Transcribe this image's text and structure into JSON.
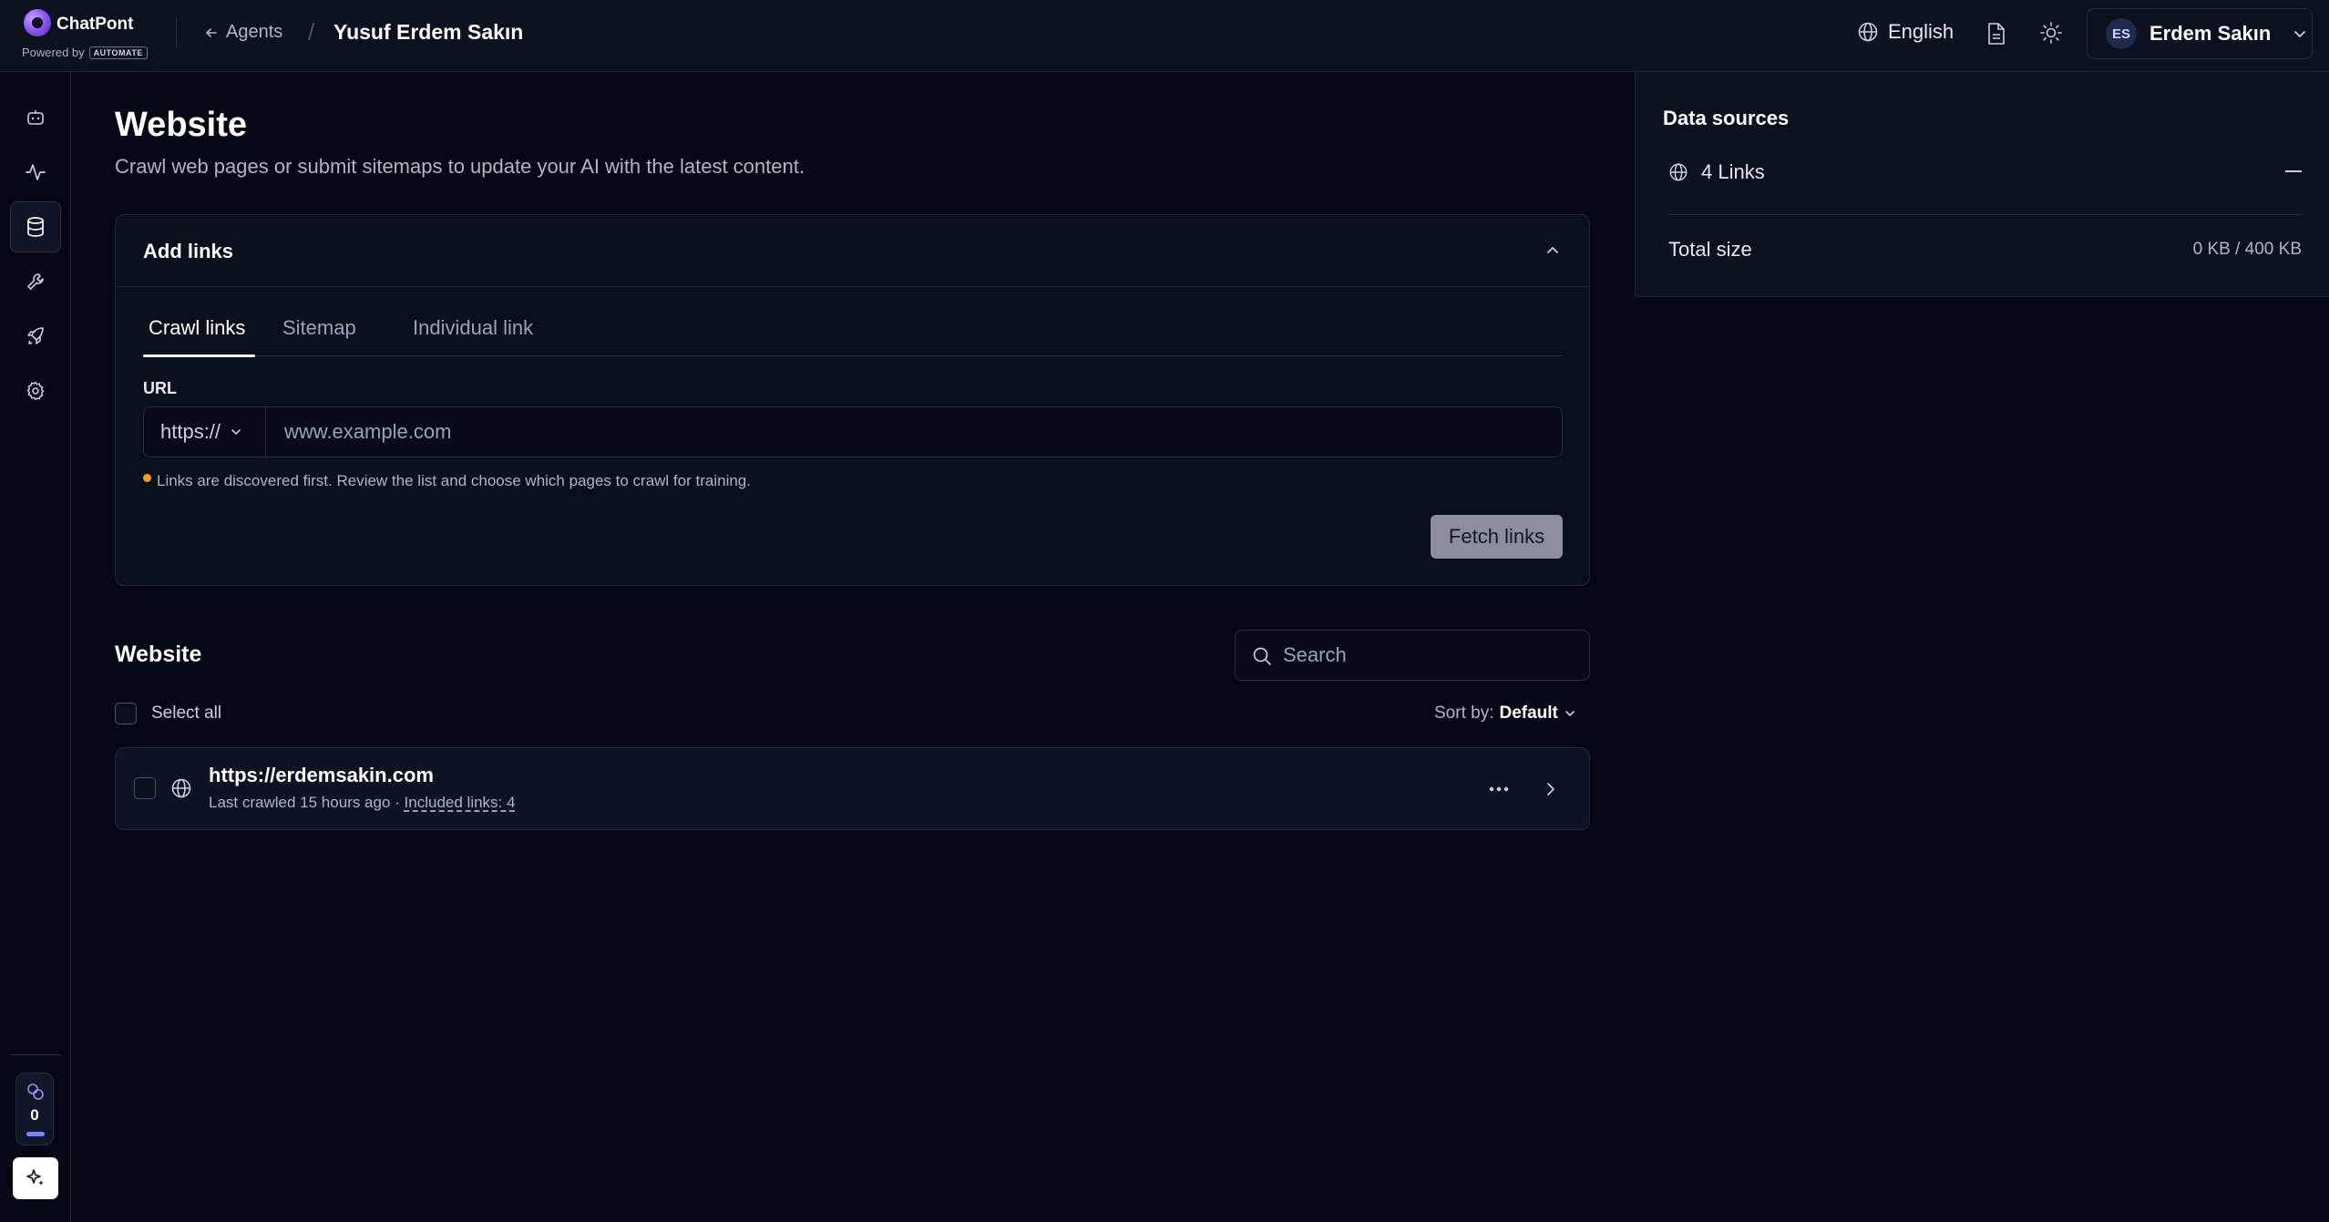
{
  "header": {
    "app_name": "ChatPont",
    "powered_by": "Powered by",
    "powered_brand": "AUTOMATE",
    "back_label": "Agents",
    "breadcrumb_title": "Yusuf Erdem Sakın",
    "language": "English",
    "user": {
      "initials": "ES",
      "name": "Erdem Sakın"
    }
  },
  "rail": {
    "items": [
      {
        "name": "agent",
        "icon": "bot-icon"
      },
      {
        "name": "activity",
        "icon": "activity-icon"
      },
      {
        "name": "data-sources",
        "icon": "database-icon",
        "active": true
      },
      {
        "name": "actions",
        "icon": "wrench-icon"
      },
      {
        "name": "deploy",
        "icon": "rocket-icon"
      },
      {
        "name": "settings",
        "icon": "gear-icon"
      }
    ],
    "credits": "0",
    "credits_level": 0
  },
  "main": {
    "title": "Website",
    "subtitle": "Crawl web pages or submit sitemaps to update your AI with the latest content.",
    "add_links": {
      "title": "Add links",
      "tabs": [
        "Crawl links",
        "Sitemap",
        "Individual link"
      ],
      "active_tab": 0,
      "url_label": "URL",
      "protocol": "https://",
      "url_placeholder": "www.example.com",
      "url_value": "",
      "hint": "Links are discovered first. Review the list and choose which pages to crawl for training.",
      "fetch_button": "Fetch links"
    },
    "website_list": {
      "title": "Website",
      "search_placeholder": "Search",
      "select_all": "Select all",
      "sort_label": "Sort by:",
      "sort_value": "Default",
      "items": [
        {
          "url": "https://erdemsakin.com",
          "last_crawled": "Last crawled 15 hours ago",
          "separator": "·",
          "included": "Included links: 4"
        }
      ]
    }
  },
  "sources_panel": {
    "title": "Data sources",
    "links_label": "4 Links",
    "total_label": "Total size",
    "total_value": "0 KB / 400 KB"
  },
  "colors": {
    "background": "#050814",
    "surface": "#0c1120",
    "accent": "#8b5cf6",
    "hint_dot": "#f59e0b",
    "credits_bar": "#7c83f2"
  }
}
